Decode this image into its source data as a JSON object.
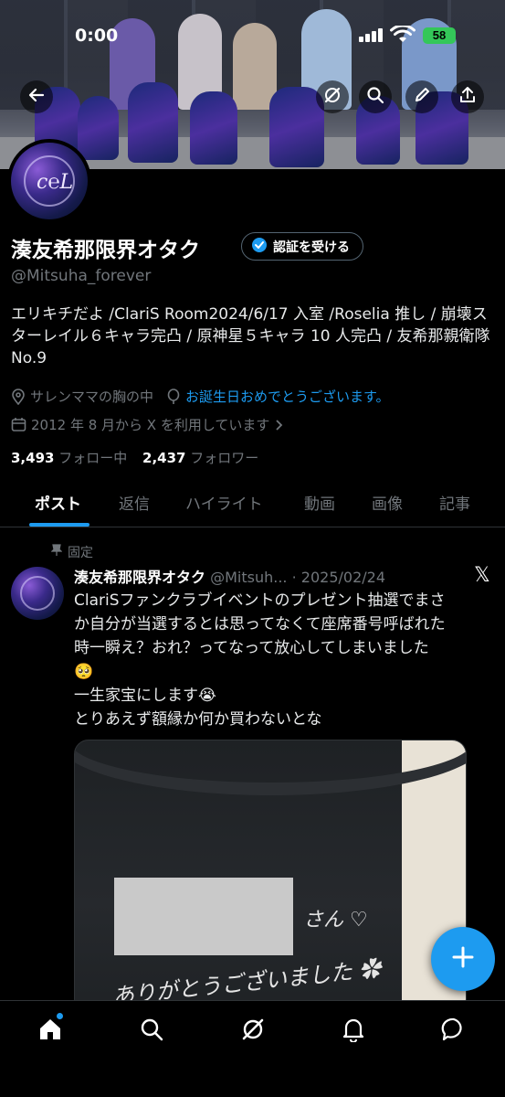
{
  "status_bar": {
    "time": "0:00",
    "battery": "58"
  },
  "profile": {
    "name": "湊友希那限界オタク",
    "verify_label": "認証を受ける",
    "handle": "@Mitsuha_forever",
    "bio": "エリキチだよ /ClariS Room2024/6/17 入室 /Roselia 推し / 崩壊スターレイル６キャラ完凸 / 原神星５キャラ 10 人完凸 / 友希那親衛隊 No.9",
    "location": "サレンママの胸の中",
    "birthday": "お誕生日おめでとうございます。",
    "joined": "2012 年 8 月から X を利用しています",
    "following_count": "3,493",
    "following_label": "フォロー中",
    "followers_count": "2,437",
    "followers_label": "フォロワー",
    "avatar_logo": "c℮L"
  },
  "tabs": [
    {
      "label": "ポスト"
    },
    {
      "label": "返信"
    },
    {
      "label": "ハイライト"
    },
    {
      "label": "動画"
    },
    {
      "label": "画像"
    },
    {
      "label": "記事"
    }
  ],
  "tweet": {
    "pinned_label": "固定",
    "name": "湊友希那限界オタク",
    "handle": "@Mitsuh...",
    "date": "· 2025/02/24",
    "x_icon": "𝕏",
    "lines": [
      "ClariSファンクラブイベントのプレゼント抽選でまさ",
      "か自分が当選するとは思ってなくて座席番号呼ばれた",
      "時一瞬え？おれ？ってなって放心してしまいました",
      "🥺",
      "一生家宝にします😭",
      "とりあえず額縁か何か買わないとな"
    ],
    "media_text_1": "さん ♡",
    "media_text_2": "ありがとうございました ✿"
  },
  "colors": {
    "accent": "#1d9bf0",
    "background": "#000000",
    "muted": "#71767b"
  },
  "icons": [
    "back-arrow-icon",
    "grok-icon",
    "search-icon",
    "edit-icon",
    "share-icon",
    "location-icon",
    "balloon-icon",
    "calendar-icon",
    "pin-icon",
    "home-icon",
    "notifications-icon",
    "messages-icon",
    "plus-icon"
  ]
}
